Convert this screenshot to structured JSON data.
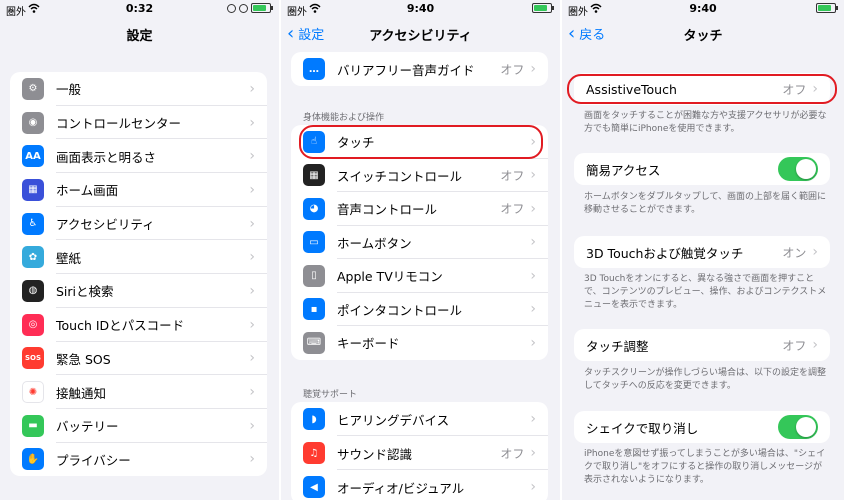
{
  "panel1": {
    "status": {
      "carrier": "圏外",
      "time": "0:32"
    },
    "title": "設定",
    "items": [
      {
        "label": "一般",
        "icon": "gear-icon",
        "color": "#8e8e93",
        "glyph": "⚙"
      },
      {
        "label": "コントロールセンター",
        "icon": "toggles-icon",
        "color": "#8e8e93",
        "glyph": "◉"
      },
      {
        "label": "画面表示と明るさ",
        "icon": "text-size-icon",
        "color": "#007aff",
        "glyph": "AA"
      },
      {
        "label": "ホーム画面",
        "icon": "grid-icon",
        "color": "#3a50d9",
        "glyph": "▦"
      },
      {
        "label": "アクセシビリティ",
        "icon": "accessibility-icon",
        "color": "#007aff",
        "glyph": "♿"
      },
      {
        "label": "壁紙",
        "icon": "flower-icon",
        "color": "#35aadc",
        "glyph": "✿"
      },
      {
        "label": "Siriと検索",
        "icon": "siri-icon",
        "color": "#222222",
        "glyph": "◍"
      },
      {
        "label": "Touch IDとパスコード",
        "icon": "fingerprint-icon",
        "color": "#ff2d55",
        "glyph": "◎"
      },
      {
        "label": "緊急 SOS",
        "icon": "sos-icon",
        "color": "#ff3b30",
        "glyph": "SOS"
      },
      {
        "label": "接触通知",
        "icon": "exposure-icon",
        "color": "#ffffff",
        "glyph": "✺"
      },
      {
        "label": "バッテリー",
        "icon": "battery-icon",
        "color": "#34c759",
        "glyph": "▬"
      },
      {
        "label": "プライバシー",
        "icon": "hand-icon",
        "color": "#007aff",
        "glyph": "✋"
      }
    ]
  },
  "panel2": {
    "status": {
      "carrier": "圏外",
      "time": "9:40"
    },
    "back": "設定",
    "title": "アクセシビリティ",
    "top_item": {
      "label": "バリアフリー音声ガイド",
      "value": "オフ",
      "icon": "speech-bubble-icon",
      "color": "#007aff",
      "glyph": "…"
    },
    "section_motor": "身体機能および操作",
    "motor_items": [
      {
        "label": "タッチ",
        "value": "",
        "icon": "touch-hand-icon",
        "color": "#007aff",
        "glyph": "☝"
      },
      {
        "label": "スイッチコントロール",
        "value": "オフ",
        "icon": "switch-control-icon",
        "color": "#222222",
        "glyph": "▦"
      },
      {
        "label": "音声コントロール",
        "value": "オフ",
        "icon": "voice-control-icon",
        "color": "#007aff",
        "glyph": "◕"
      },
      {
        "label": "ホームボタン",
        "value": "",
        "icon": "home-button-icon",
        "color": "#007aff",
        "glyph": "▭"
      },
      {
        "label": "Apple TVリモコン",
        "value": "",
        "icon": "remote-icon",
        "color": "#8e8e93",
        "glyph": "▯"
      },
      {
        "label": "ポインタコントロール",
        "value": "",
        "icon": "pointer-icon",
        "color": "#007aff",
        "glyph": "▪"
      },
      {
        "label": "キーボード",
        "value": "",
        "icon": "keyboard-icon",
        "color": "#8e8e93",
        "glyph": "⌨"
      }
    ],
    "section_hearing": "聴覚サポート",
    "hearing_items": [
      {
        "label": "ヒアリングデバイス",
        "value": "",
        "icon": "ear-icon",
        "color": "#007aff",
        "glyph": "◗"
      },
      {
        "label": "サウンド認識",
        "value": "オフ",
        "icon": "sound-recognition-icon",
        "color": "#ff3b30",
        "glyph": "♫"
      },
      {
        "label": "オーディオ/ビジュアル",
        "value": "",
        "icon": "speaker-icon",
        "color": "#007aff",
        "glyph": "◀"
      }
    ]
  },
  "panel3": {
    "status": {
      "carrier": "圏外",
      "time": "9:40"
    },
    "back": "戻る",
    "title": "タッチ",
    "assistive": {
      "label": "AssistiveTouch",
      "value": "オフ"
    },
    "assistive_footer": "画面をタッチすることが困難な方や支援アクセサリが必要な方でも簡単にiPhoneを使用できます。",
    "reachability": {
      "label": "簡易アクセス",
      "on": true
    },
    "reachability_footer": "ホームボタンをダブルタップして、画面の上部を届く範囲に移動させることができます。",
    "haptic": {
      "label": "3D Touchおよび触覚タッチ",
      "value": "オン"
    },
    "haptic_footer": "3D Touchをオンにすると、異なる強さで画面を押すことで、コンテンツのプレビュー、操作、およびコンテクストメニューを表示できます。",
    "accommodations": {
      "label": "タッチ調整",
      "value": "オフ"
    },
    "accommodations_footer": "タッチスクリーンが操作しづらい場合は、以下の設定を調整してタッチへの反応を変更できます。",
    "shake": {
      "label": "シェイクで取り消し",
      "on": true
    },
    "shake_footer": "iPhoneを意図せず振ってしまうことが多い場合は、\"シェイクで取り消し\"をオフにすると操作の取り消しメッセージが表示されないようになります。"
  },
  "colors": {
    "accent": "#007aff",
    "highlight": "#e11b22",
    "toggle_on": "#34c759"
  }
}
